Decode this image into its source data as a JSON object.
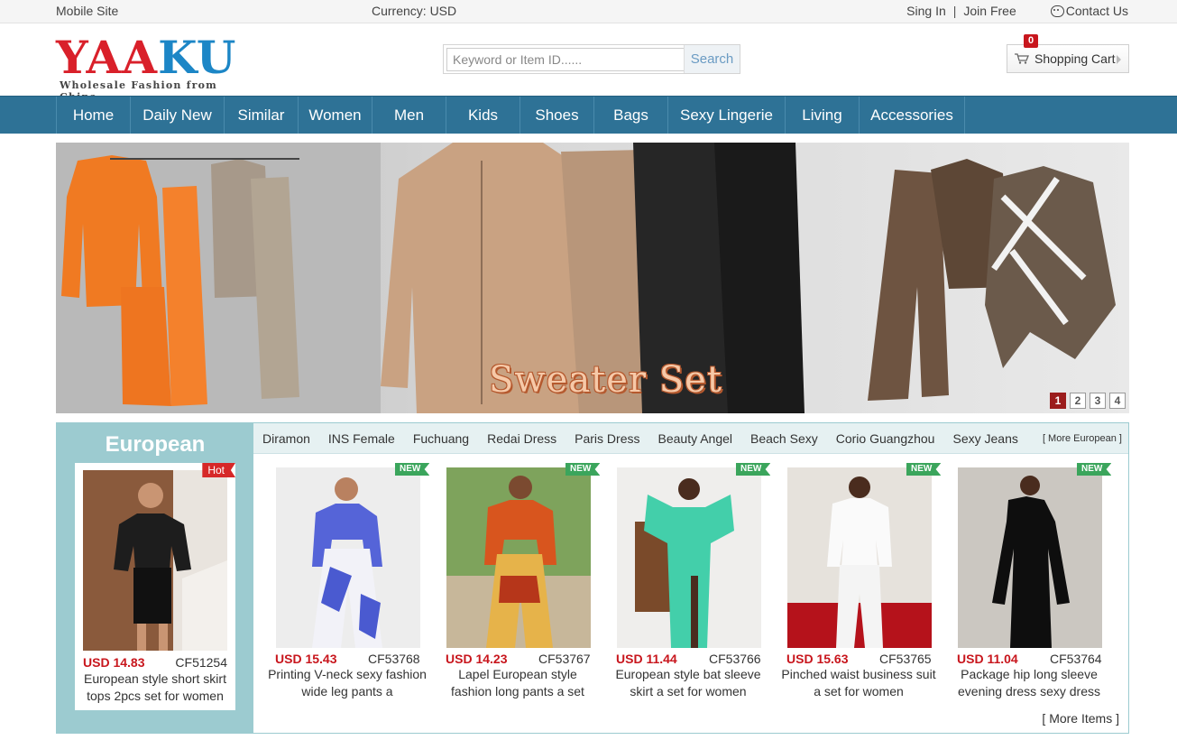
{
  "topbar": {
    "mobile": "Mobile Site",
    "currency": "Currency: USD",
    "sign_in": "Sing In",
    "separator": "|",
    "join": "Join Free",
    "contact": "Contact Us"
  },
  "header": {
    "logo_red": "YAA",
    "logo_blue": "KU",
    "tagline": "Wholesale Fashion from China",
    "search_placeholder": "Keyword or Item ID......",
    "search_button": "Search",
    "cart_label": "Shopping Cart",
    "cart_count": "0"
  },
  "nav": {
    "items": [
      "Home",
      "Daily New",
      "Similar",
      "Women",
      "Men",
      "Kids",
      "Shoes",
      "Bags",
      "Sexy Lingerie",
      "Living",
      "Accessories"
    ]
  },
  "banner": {
    "caption": "Sweater Set",
    "pages": [
      "1",
      "2",
      "3",
      "4"
    ],
    "active_page": "1"
  },
  "section": {
    "title": "European",
    "featured": {
      "badge": "Hot",
      "price": "USD 14.83",
      "code": "CF51254",
      "name": "European style short skirt tops 2pcs set for women"
    },
    "tabs": [
      "Diramon",
      "INS Female",
      "Fuchuang",
      "Redai Dress",
      "Paris Dress",
      "Beauty Angel",
      "Beach Sexy",
      "Corio Guangzhou",
      "Sexy Jeans"
    ],
    "more_tab": "[ More European ]",
    "new_badge": "NEW",
    "products": [
      {
        "price": "USD 15.43",
        "code": "CF53768",
        "name": "Printing V-neck sexy fashion wide leg pants a"
      },
      {
        "price": "USD 14.23",
        "code": "CF53767",
        "name": "Lapel European style fashion long pants a set"
      },
      {
        "price": "USD 11.44",
        "code": "CF53766",
        "name": "European style bat sleeve skirt a set for women"
      },
      {
        "price": "USD 15.63",
        "code": "CF53765",
        "name": "Pinched waist business suit a set for women"
      },
      {
        "price": "USD 11.04",
        "code": "CF53764",
        "name": "Package hip long sleeve evening dress sexy dress"
      }
    ],
    "more_items": "[ More Items ]"
  },
  "colors": {
    "nav_bg": "#2e7296",
    "section_accent": "#9ccbd0",
    "price_red": "#c8161d",
    "new_green": "#3ba55c"
  }
}
